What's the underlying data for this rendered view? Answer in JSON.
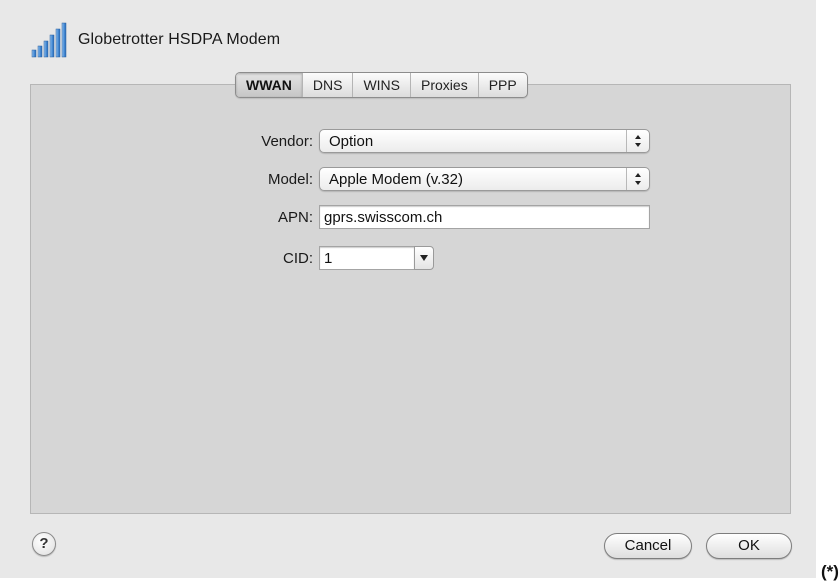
{
  "window": {
    "title": "Globetrotter HSDPA Modem",
    "icon": "signal-strength-icon"
  },
  "tabs": [
    {
      "label": "WWAN",
      "selected": true
    },
    {
      "label": "DNS",
      "selected": false
    },
    {
      "label": "WINS",
      "selected": false
    },
    {
      "label": "Proxies",
      "selected": false
    },
    {
      "label": "PPP",
      "selected": false
    }
  ],
  "form": {
    "vendor": {
      "label": "Vendor:",
      "value": "Option"
    },
    "model": {
      "label": "Model:",
      "value": "Apple Modem (v.32)"
    },
    "apn": {
      "label": "APN:",
      "value": "gprs.swisscom.ch"
    },
    "cid": {
      "label": "CID:",
      "value": "1"
    }
  },
  "buttons": {
    "help": "?",
    "cancel": "Cancel",
    "ok": "OK"
  },
  "footnote": "(*)",
  "colors": {
    "window_bg": "#e8e8e8",
    "panel_bg": "#d6d6d6",
    "signal_blue": "#4a8fd8"
  }
}
